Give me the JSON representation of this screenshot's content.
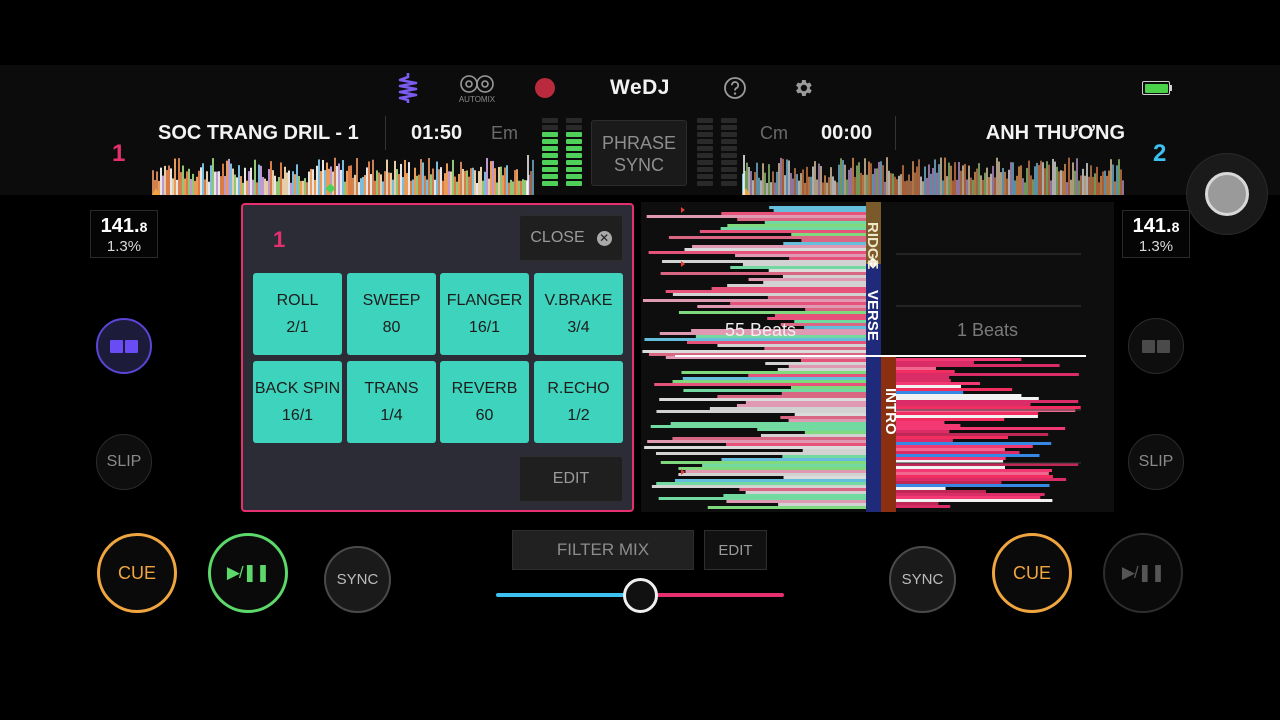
{
  "app": {
    "logo": "WeDJ",
    "automix_label": "AUTOMIX"
  },
  "icons": {
    "waveform_icon": "waveform-icon",
    "automix_icon": "automix-icon",
    "record_icon": "record-icon",
    "help_icon": "help-icon",
    "settings_icon": "gear-icon",
    "battery_icon": "battery-icon"
  },
  "colors": {
    "deck1_accent": "#e62f6e",
    "deck2_accent": "#3cc1f2",
    "fx_pad": "#3ed3bc",
    "cue": "#f0a640",
    "play": "#5dd86a",
    "automix_accent": "#7c5cf0"
  },
  "deck1": {
    "number": "1",
    "title": "SOC TRANG DRIL - 1",
    "time": "01:50",
    "key": "Em",
    "bpm_main": "141.",
    "bpm_decimal": "8",
    "pitch": "1.3%",
    "beats": "55 Beats",
    "slip": "SLIP",
    "cue": "CUE",
    "play": "▶/❚❚",
    "sync": "SYNC"
  },
  "deck2": {
    "number": "2",
    "title": "ANH THƯƠNG",
    "time": "00:00",
    "key": "Cm",
    "bpm_main": "141.",
    "bpm_decimal": "8",
    "pitch": "1.3%",
    "beats": "1 Beats",
    "slip": "SLIP",
    "cue": "CUE",
    "play": "▶/❚❚",
    "sync": "SYNC"
  },
  "phrase_sync": {
    "line1": "PHRASE",
    "line2": "SYNC"
  },
  "fx_panel": {
    "deck": "1",
    "close": "CLOSE",
    "edit": "EDIT",
    "pads": [
      {
        "name": "ROLL",
        "value": "2/1"
      },
      {
        "name": "SWEEP",
        "value": "80"
      },
      {
        "name": "FLANGER",
        "value": "16/1"
      },
      {
        "name": "V.BRAKE",
        "value": "3/4"
      },
      {
        "name": "BACK SPIN",
        "value": "16/1"
      },
      {
        "name": "TRANS",
        "value": "1/4"
      },
      {
        "name": "REVERB",
        "value": "60"
      },
      {
        "name": "R.ECHO",
        "value": "1/2"
      }
    ]
  },
  "phrases": {
    "bridge": "RIDGE",
    "verse": "VERSE",
    "intro": "INTRO"
  },
  "mixer": {
    "filter_mix": "FILTER MIX",
    "edit": "EDIT",
    "crossfader_position": 0.5
  }
}
